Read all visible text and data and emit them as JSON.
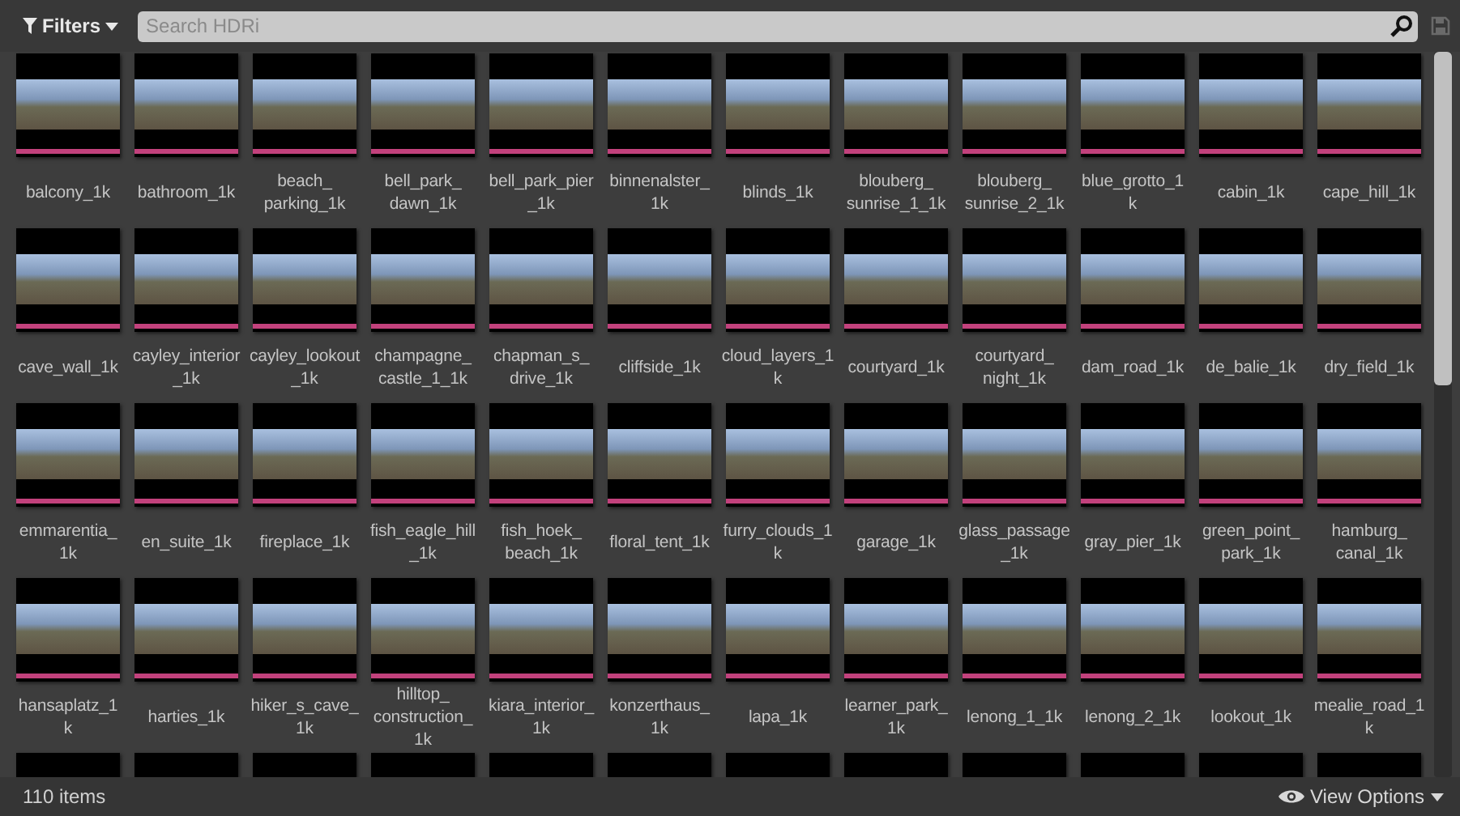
{
  "toolbar": {
    "filters": "Filters",
    "search": {
      "placeholder": "Search HDRi"
    }
  },
  "assets": [
    {
      "lines": [
        "balcony_1k"
      ]
    },
    {
      "lines": [
        "bathroom_1k"
      ]
    },
    {
      "lines": [
        "beach_",
        "parking_1k"
      ]
    },
    {
      "lines": [
        "bell_park_",
        "dawn_1k"
      ]
    },
    {
      "lines": [
        "bell_park_pier",
        "_1k"
      ]
    },
    {
      "lines": [
        "binnenalster_",
        "1k"
      ]
    },
    {
      "lines": [
        "blinds_1k"
      ]
    },
    {
      "lines": [
        "blouberg_",
        "sunrise_1_1k"
      ]
    },
    {
      "lines": [
        "blouberg_",
        "sunrise_2_1k"
      ]
    },
    {
      "lines": [
        "blue_grotto_1",
        "k"
      ]
    },
    {
      "lines": [
        "cabin_1k"
      ]
    },
    {
      "lines": [
        "cape_hill_1k"
      ]
    },
    {
      "lines": [
        "cave_wall_1k"
      ]
    },
    {
      "lines": [
        "cayley_interior",
        "_1k"
      ]
    },
    {
      "lines": [
        "cayley_lookout",
        "_1k"
      ]
    },
    {
      "lines": [
        "champagne_",
        "castle_1_1k"
      ]
    },
    {
      "lines": [
        "chapman_s_",
        "drive_1k"
      ]
    },
    {
      "lines": [
        "cliffside_1k"
      ]
    },
    {
      "lines": [
        "cloud_layers_1",
        "k"
      ]
    },
    {
      "lines": [
        "courtyard_1k"
      ]
    },
    {
      "lines": [
        "courtyard_",
        "night_1k"
      ]
    },
    {
      "lines": [
        "dam_road_1k"
      ]
    },
    {
      "lines": [
        "de_balie_1k"
      ]
    },
    {
      "lines": [
        "dry_field_1k"
      ]
    },
    {
      "lines": [
        "emmarentia_",
        "1k"
      ]
    },
    {
      "lines": [
        "en_suite_1k"
      ]
    },
    {
      "lines": [
        "fireplace_1k"
      ]
    },
    {
      "lines": [
        "fish_eagle_hill",
        "_1k"
      ]
    },
    {
      "lines": [
        "fish_hoek_",
        "beach_1k"
      ]
    },
    {
      "lines": [
        "floral_tent_1k"
      ]
    },
    {
      "lines": [
        "furry_clouds_1",
        "k"
      ]
    },
    {
      "lines": [
        "garage_1k"
      ]
    },
    {
      "lines": [
        "glass_passage",
        "_1k"
      ]
    },
    {
      "lines": [
        "gray_pier_1k"
      ]
    },
    {
      "lines": [
        "green_point_",
        "park_1k"
      ]
    },
    {
      "lines": [
        "hamburg_",
        "canal_1k"
      ]
    },
    {
      "lines": [
        "hansaplatz_1",
        "k"
      ]
    },
    {
      "lines": [
        "harties_1k"
      ]
    },
    {
      "lines": [
        "hiker_s_cave_",
        "1k"
      ]
    },
    {
      "lines": [
        "hilltop_",
        "construction_",
        "1k"
      ]
    },
    {
      "lines": [
        "kiara_interior_",
        "1k"
      ]
    },
    {
      "lines": [
        "konzerthaus_",
        "1k"
      ]
    },
    {
      "lines": [
        "lapa_1k"
      ]
    },
    {
      "lines": [
        "learner_park_",
        "1k"
      ]
    },
    {
      "lines": [
        "lenong_1_1k"
      ]
    },
    {
      "lines": [
        "lenong_2_1k"
      ]
    },
    {
      "lines": [
        "lookout_1k"
      ]
    },
    {
      "lines": [
        "mealie_road_1",
        "k"
      ]
    }
  ],
  "status_bar": {
    "count": "110 items",
    "view_options": "View Options"
  }
}
